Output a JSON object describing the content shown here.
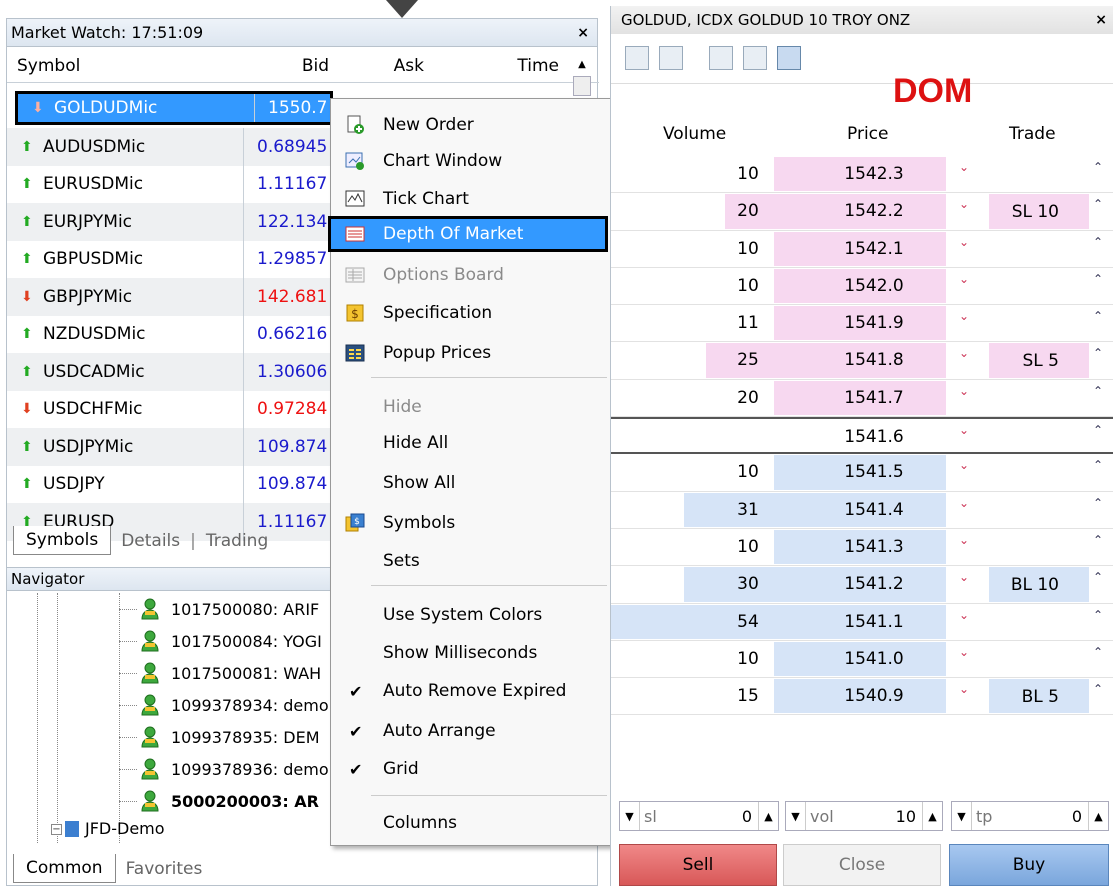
{
  "market_watch": {
    "title": "Market Watch: 17:51:09",
    "close": "×",
    "columns": {
      "symbol": "Symbol",
      "bid": "Bid",
      "ask": "Ask",
      "time": "Time"
    },
    "rows": [
      {
        "symbol": "GOLDUDMic",
        "bid": "1550.7",
        "dir": "down"
      },
      {
        "symbol": "AUDUSDMic",
        "bid": "0.68945",
        "dir": "up"
      },
      {
        "symbol": "EURUSDMic",
        "bid": "1.11167",
        "dir": "up"
      },
      {
        "symbol": "EURJPYMic",
        "bid": "122.134",
        "dir": "up"
      },
      {
        "symbol": "GBPUSDMic",
        "bid": "1.29857",
        "dir": "up"
      },
      {
        "symbol": "GBPJPYMic",
        "bid": "142.681",
        "dir": "down"
      },
      {
        "symbol": "NZDUSDMic",
        "bid": "0.66216",
        "dir": "up"
      },
      {
        "symbol": "USDCADMic",
        "bid": "1.30606",
        "dir": "up"
      },
      {
        "symbol": "USDCHFMic",
        "bid": "0.97284",
        "dir": "down"
      },
      {
        "symbol": "USDJPYMic",
        "bid": "109.874",
        "dir": "up"
      },
      {
        "symbol": "USDJPY",
        "bid": "109.874",
        "dir": "up"
      },
      {
        "symbol": "EURUSD",
        "bid": "1.11167",
        "dir": "up"
      }
    ],
    "tabs": [
      "Symbols",
      "Details",
      "Trading"
    ]
  },
  "navigator": {
    "title": "Navigator",
    "accounts": [
      "1017500080: ARIF",
      "1017500084: YOGI",
      "1017500081: WAH",
      "1099378934: demo",
      "1099378935: DEM",
      "1099378936: demo",
      "5000200003: AR"
    ],
    "server": "JFD-Demo",
    "tabs": [
      "Common",
      "Favorites"
    ]
  },
  "context_menu": {
    "items": {
      "new_order": "New Order",
      "chart_window": "Chart Window",
      "tick_chart": "Tick Chart",
      "depth_of_market": "Depth Of Market",
      "options_board": "Options Board",
      "specification": "Specification",
      "popup_prices": "Popup Prices",
      "hide": "Hide",
      "hide_all": "Hide All",
      "show_all": "Show All",
      "symbols": "Symbols",
      "sets": "Sets",
      "use_system_colors": "Use System Colors",
      "show_milliseconds": "Show Milliseconds",
      "auto_remove_expired": "Auto Remove Expired",
      "auto_arrange": "Auto Arrange",
      "grid": "Grid",
      "columns": "Columns"
    },
    "check": "✔"
  },
  "dom": {
    "title": "GOLDUD, ICDX GOLDUD 10 TROY ONZ",
    "close": "×",
    "label": "DOM",
    "headers": {
      "volume": "Volume",
      "price": "Price",
      "trade": "Trade"
    },
    "rows": [
      {
        "vol": "10",
        "price": "1542.3",
        "side": "ask",
        "bar": 0.0,
        "trade": ""
      },
      {
        "vol": "20",
        "price": "1542.2",
        "side": "ask",
        "bar": 0.3,
        "trade": "SL 10"
      },
      {
        "vol": "10",
        "price": "1542.1",
        "side": "ask",
        "bar": 0.0,
        "trade": ""
      },
      {
        "vol": "10",
        "price": "1542.0",
        "side": "ask",
        "bar": 0.0,
        "trade": ""
      },
      {
        "vol": "11",
        "price": "1541.9",
        "side": "ask",
        "bar": 0.0,
        "trade": ""
      },
      {
        "vol": "25",
        "price": "1541.8",
        "side": "ask",
        "bar": 0.42,
        "trade": "SL 5"
      },
      {
        "vol": "20",
        "price": "1541.7",
        "side": "ask",
        "bar": 0.0,
        "trade": ""
      },
      {
        "vol": "",
        "price": "1541.6",
        "side": "mid",
        "bar": 0.0,
        "trade": ""
      },
      {
        "vol": "10",
        "price": "1541.5",
        "side": "bid",
        "bar": 0.0,
        "trade": ""
      },
      {
        "vol": "31",
        "price": "1541.4",
        "side": "bid",
        "bar": 0.55,
        "trade": ""
      },
      {
        "vol": "10",
        "price": "1541.3",
        "side": "bid",
        "bar": 0.0,
        "trade": ""
      },
      {
        "vol": "30",
        "price": "1541.2",
        "side": "bid",
        "bar": 0.55,
        "trade": "BL 10"
      },
      {
        "vol": "54",
        "price": "1541.1",
        "side": "bid",
        "bar": 1.0,
        "trade": ""
      },
      {
        "vol": "10",
        "price": "1541.0",
        "side": "bid",
        "bar": 0.0,
        "trade": ""
      },
      {
        "vol": "15",
        "price": "1540.9",
        "side": "bid",
        "bar": 0.0,
        "trade": "BL 5"
      }
    ],
    "inputs": {
      "sl": {
        "placeholder": "sl",
        "value": "0"
      },
      "vol": {
        "placeholder": "vol",
        "value": "10"
      },
      "tp": {
        "placeholder": "tp",
        "value": "0"
      }
    },
    "buttons": {
      "sell": "Sell",
      "close": "Close",
      "buy": "Buy"
    }
  },
  "colors": {
    "selection": "#3399ff",
    "up_arrow": "#22aa22",
    "down_arrow": "#e04020",
    "bid_blue": "#1a1acc",
    "bid_red": "#ee1111",
    "dom_label": "#dd1111",
    "ask_pink": "#f7d8f0",
    "bid_blue_bg": "#d6e4f7"
  }
}
